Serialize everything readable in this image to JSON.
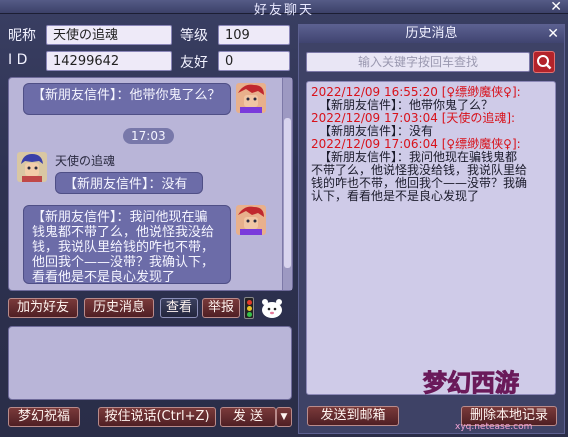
{
  "window": {
    "title": "好友聊天",
    "close_glyph": "✕"
  },
  "info": {
    "nickname_label": "昵称",
    "nickname_value": "天使の追魂",
    "level_label": "等级",
    "level_value": "109",
    "id_label": "I D",
    "id_value": "14299642",
    "friendship_label": "友好",
    "friendship_value": "0"
  },
  "chat": {
    "messages": [
      {
        "text": "【新朋友信件】：他带你鬼了么？"
      },
      {
        "time": "17:03"
      },
      {
        "sender": "天使の追魂",
        "text": "【新朋友信件】：没有"
      },
      {
        "text_lines": [
          "【新朋友信件】：我问他现在骗",
          "钱鬼都不带了么，他说怪我没给",
          "钱，我说队里给钱的咋也不带，",
          "他回我个——没带？我确认下，",
          "看看他是不是良心发现了"
        ]
      }
    ]
  },
  "buttons": {
    "add_friend": "加为好友",
    "history": "历史消息",
    "view": "查看",
    "report": "举报",
    "blessing": "梦幻祝福",
    "push_to_talk": "按住说话(Ctrl+Z)",
    "send": "发 送",
    "send_dropdown": "▼"
  },
  "history": {
    "title": "历史消息",
    "close_glyph": "✕",
    "search_placeholder": "输入关键字按回车查找",
    "log": [
      {
        "header": "2022/12/09 16:55:20 [♀缥缈魔侠♀]:",
        "body": [
          "【新朋友信件】：他带你鬼了么？"
        ]
      },
      {
        "header": "2022/12/09 17:03:04 [天使の追魂]:",
        "body": [
          "【新朋友信件】：没有"
        ]
      },
      {
        "header": "2022/12/09 17:06:04 [♀缥缈魔侠♀]:",
        "body": [
          "【新朋友信件】：我问他现在骗钱鬼都",
          "不带了么，他说怪我没给钱，我说队里给",
          "钱的咋也不带，他回我个——没带？我确",
          "认下，看看他是不是良心发现了"
        ]
      }
    ],
    "send_to_mail": "发送到邮箱",
    "delete_local": "删除本地记录"
  },
  "logo": {
    "text": "梦幻西游",
    "sub": "xyq.netease.com"
  },
  "colors": {
    "accent_red": "#d8121b",
    "bubble": "#6c6ca8",
    "button": "#6a2c30"
  }
}
